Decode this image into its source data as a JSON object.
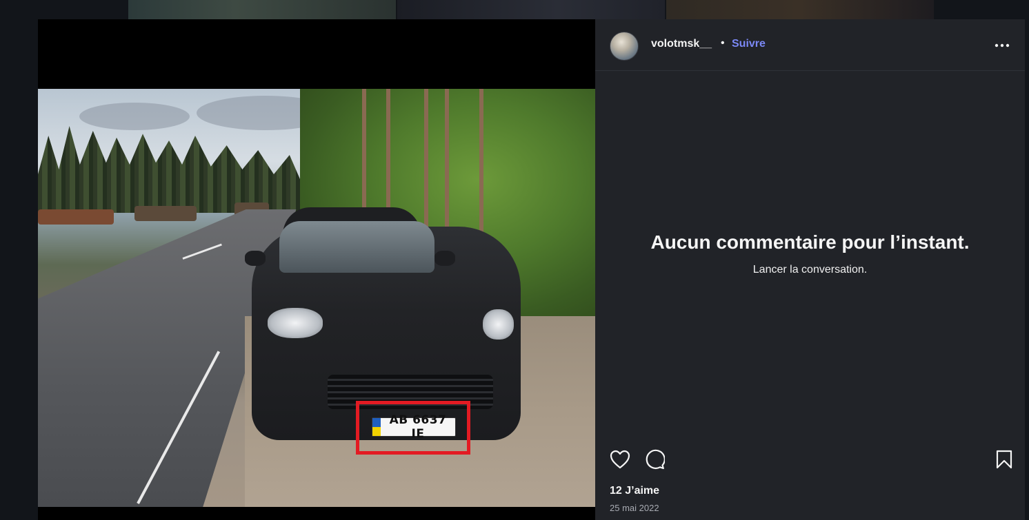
{
  "post": {
    "plate_text": "AB 6637 IE",
    "highlight_color": "#e31b23"
  },
  "panel": {
    "username": "volotmsk__",
    "separator": "•",
    "follow_label": "Suivre",
    "empty_title": "Aucun commentaire pour l’instant.",
    "empty_subtitle": "Lancer la conversation.",
    "likes": "12 J’aime",
    "date": "25 mai 2022"
  },
  "icons": {
    "more": "more-horizontal-icon",
    "like": "heart-icon",
    "comment": "comment-icon",
    "save": "bookmark-icon"
  },
  "colors": {
    "panel_bg": "#212328",
    "follow_link": "#7b88f5",
    "page_bg": "#12151a"
  }
}
